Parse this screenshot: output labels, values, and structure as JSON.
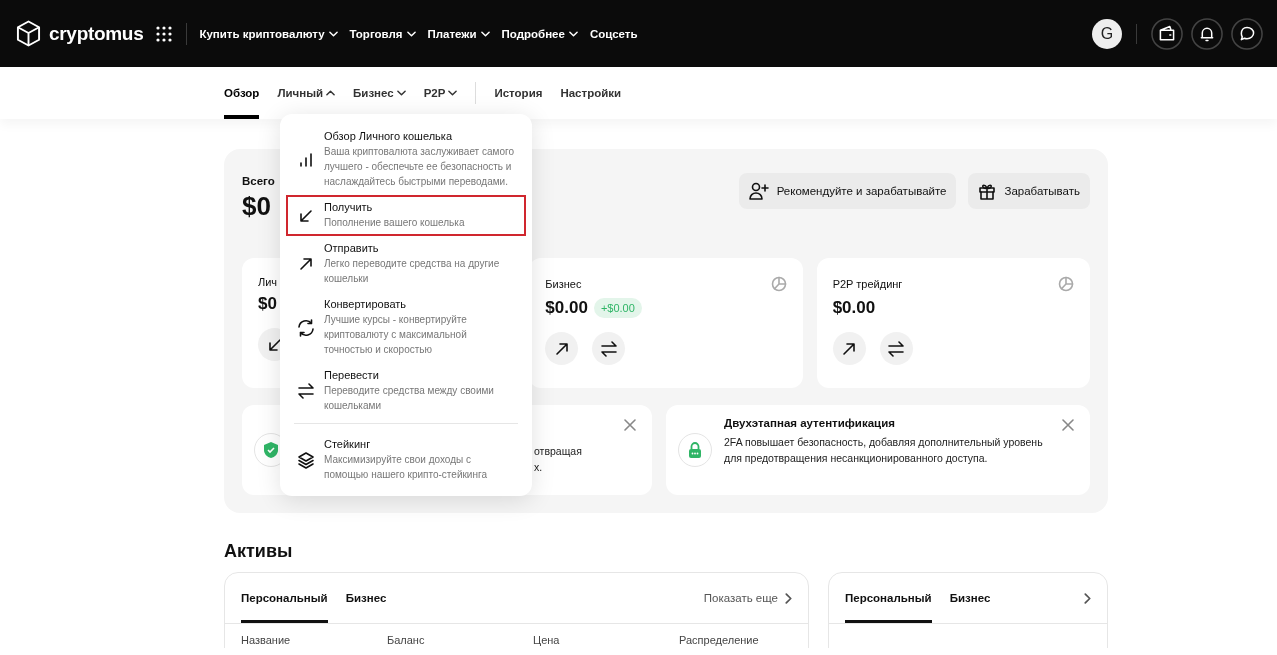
{
  "header": {
    "brand": "cryptomus",
    "nav": [
      {
        "label": "Купить криптовалюту"
      },
      {
        "label": "Торговля"
      },
      {
        "label": "Платежи"
      },
      {
        "label": "Подробнее"
      },
      {
        "label": "Соцсеть",
        "kind": "plain"
      }
    ],
    "avatar": "G"
  },
  "subnav": {
    "tabs": [
      {
        "label": "Обзор",
        "kind": "plain",
        "selected": true
      },
      {
        "label": "Личный",
        "kind": "menu",
        "selected": false,
        "expanded": true
      },
      {
        "label": "Бизнес",
        "kind": "menu",
        "selected": false,
        "expanded": false
      },
      {
        "label": "P2P",
        "kind": "menu",
        "selected": false,
        "expanded": false
      }
    ],
    "links": [
      "История",
      "Настройки"
    ]
  },
  "dropdown_menu": {
    "items": [
      {
        "kind": "overview",
        "title": "Обзор Личного кошелька",
        "description": "Ваша криптовалюта заслуживает самого лучшего - обеспечьте ее безопасность и наслаждайтесь быстрыми переводами.",
        "highlighted": false
      },
      {
        "kind": "receive",
        "title": "Получить",
        "description": "Пополнение вашего кошелька",
        "highlighted": true
      },
      {
        "kind": "send",
        "title": "Отправить",
        "description": "Легко переводите средства на другие кошельки",
        "highlighted": false
      },
      {
        "kind": "convert",
        "title": "Конвертировать",
        "description": "Лучшие курсы - конвертируйте криптовалюту с максимальной точностью и скоростью",
        "highlighted": false
      },
      {
        "kind": "transfer",
        "title": "Перевести",
        "description": "Переводите средства между своими кошельками",
        "highlighted": false
      }
    ],
    "footer_items": [
      {
        "kind": "staking",
        "title": "Стейкинг",
        "description": "Максимизируйте свои доходы с помощью нашего крипто-стейкинга",
        "highlighted": false
      }
    ]
  },
  "overview": {
    "total_label": "Всего",
    "total": "$0",
    "actions": [
      {
        "kind": "referral",
        "label": "Рекомендуйте и зарабатывайте"
      },
      {
        "kind": "rewards",
        "label": "Зарабатывать"
      }
    ],
    "wallets": [
      {
        "kind": "personal",
        "label": "Лич",
        "amount": "$0",
        "stats_icon": false
      },
      {
        "kind": "outgoing",
        "label": "Бизнес",
        "amount": "$0.00",
        "change": "+$0.00",
        "stats_icon": true
      },
      {
        "kind": "outgoing",
        "label": "P2P трейдинг",
        "amount": "$0.00",
        "stats_icon": true
      }
    ],
    "notices": [
      {
        "kind": "security",
        "text_lines": [
          "отвращая",
          "х."
        ]
      },
      {
        "kind": "twofa",
        "title": "Двухэтапная аутентификация",
        "text": "2FA повышает безопасность, добавляя дополнительный уровень для предотвращения несанкционированного доступа."
      }
    ]
  },
  "assets": {
    "heading": "Активы",
    "main": {
      "tabs": [
        {
          "label": "Персональный",
          "selected": true
        },
        {
          "label": "Бизнес",
          "selected": false
        }
      ],
      "more": "Показать еще",
      "columns": [
        "Название",
        "Баланс",
        "Цена",
        "Распределение"
      ]
    },
    "side": {
      "tabs": [
        {
          "label": "Персональный",
          "selected": true
        },
        {
          "label": "Бизнес",
          "selected": false
        }
      ]
    }
  }
}
